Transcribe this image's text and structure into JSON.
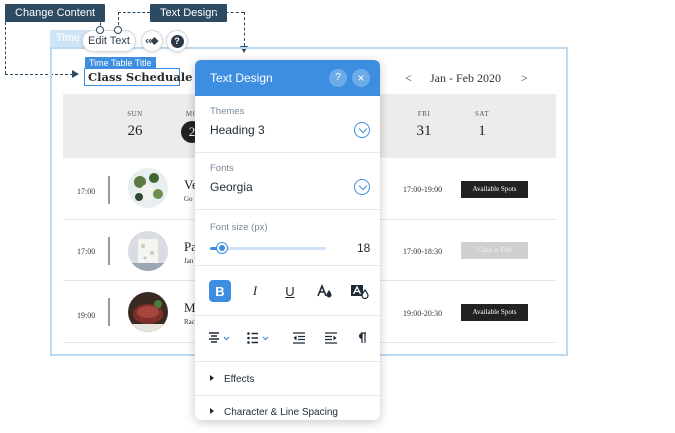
{
  "annotations": {
    "change_content": "Change Content",
    "text_design": "Text Design"
  },
  "frame": {
    "tag": "Time Table"
  },
  "toolbar": {
    "edit_text": "Edit Text"
  },
  "title_element": {
    "tag": "Time Table Title",
    "text": "Class Scheduale"
  },
  "schedule": {
    "prev": "<",
    "range": "Jan - Feb 2020",
    "next": ">",
    "days": [
      {
        "name": "SUN",
        "date": "26"
      },
      {
        "name": "MO",
        "date": "2"
      },
      {
        "name": "FRI",
        "date": "31"
      },
      {
        "name": "SAT",
        "date": "1"
      }
    ],
    "rows": [
      {
        "time": "17:00",
        "name": "Ve",
        "instructor": "Go",
        "range": "17:00-19:00",
        "button": "Available Spots",
        "status": "available"
      },
      {
        "time": "17:00",
        "name": "Pa",
        "instructor": "Jan",
        "range": "17:00-18:30",
        "button": "Class is Full",
        "status": "full"
      },
      {
        "time": "19:00",
        "name": "M",
        "instructor": "Rac",
        "range": "19:00-20:30",
        "button": "Available Spots",
        "status": "available"
      }
    ]
  },
  "panel": {
    "title": "Text Design",
    "help": "?",
    "close": "×",
    "themes_label": "Themes",
    "themes_value": "Heading 3",
    "fonts_label": "Fonts",
    "fonts_value": "Georgia",
    "font_size_label": "Font size (px)",
    "font_size_value": "18",
    "font_size_fraction": 0.1,
    "format_buttons": [
      {
        "name": "bold",
        "glyph": "B",
        "active": true
      },
      {
        "name": "italic",
        "glyph": "I",
        "active": false
      },
      {
        "name": "underline",
        "glyph": "U",
        "active": false
      }
    ],
    "effects": "Effects",
    "spacing": "Character & Line Spacing"
  },
  "colors": {
    "accent": "#3d8ee0",
    "callout": "#2d4a63",
    "available_btn": "#222222",
    "full_btn": "#cfcfcf"
  }
}
